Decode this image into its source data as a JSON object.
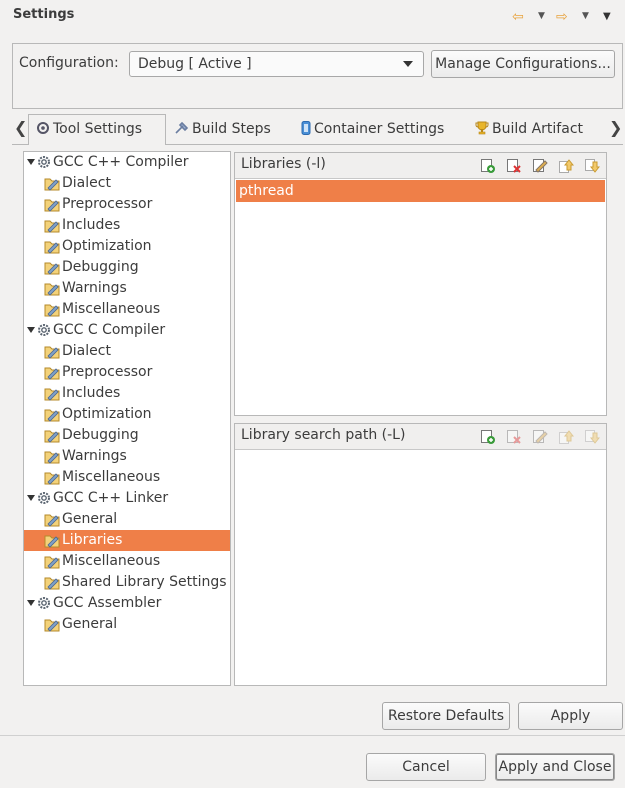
{
  "window": {
    "title": "Settings"
  },
  "configuration": {
    "label": "Configuration:",
    "selected": "Debug  [ Active ]",
    "manage_label": "Manage Configurations..."
  },
  "tabs": [
    {
      "label": "Tool Settings",
      "icon": "tool-settings-icon"
    },
    {
      "label": "Build Steps",
      "icon": "build-steps-icon"
    },
    {
      "label": "Container Settings",
      "icon": "container-icon"
    },
    {
      "label": "Build Artifact",
      "icon": "trophy-icon"
    }
  ],
  "tree": [
    {
      "label": "GCC C++ Compiler",
      "type": "group",
      "icon": "gear-icon"
    },
    {
      "label": "Dialect",
      "type": "leaf",
      "icon": "tool-option-icon"
    },
    {
      "label": "Preprocessor",
      "type": "leaf",
      "icon": "tool-option-icon"
    },
    {
      "label": "Includes",
      "type": "leaf",
      "icon": "tool-option-icon"
    },
    {
      "label": "Optimization",
      "type": "leaf",
      "icon": "tool-option-icon"
    },
    {
      "label": "Debugging",
      "type": "leaf",
      "icon": "tool-option-icon"
    },
    {
      "label": "Warnings",
      "type": "leaf",
      "icon": "tool-option-icon"
    },
    {
      "label": "Miscellaneous",
      "type": "leaf",
      "icon": "tool-option-icon"
    },
    {
      "label": "GCC C Compiler",
      "type": "group",
      "icon": "gear-icon"
    },
    {
      "label": "Dialect",
      "type": "leaf",
      "icon": "tool-option-icon"
    },
    {
      "label": "Preprocessor",
      "type": "leaf",
      "icon": "tool-option-icon"
    },
    {
      "label": "Includes",
      "type": "leaf",
      "icon": "tool-option-icon"
    },
    {
      "label": "Optimization",
      "type": "leaf",
      "icon": "tool-option-icon"
    },
    {
      "label": "Debugging",
      "type": "leaf",
      "icon": "tool-option-icon"
    },
    {
      "label": "Warnings",
      "type": "leaf",
      "icon": "tool-option-icon"
    },
    {
      "label": "Miscellaneous",
      "type": "leaf",
      "icon": "tool-option-icon"
    },
    {
      "label": "GCC C++ Linker",
      "type": "group",
      "icon": "gear-icon"
    },
    {
      "label": "General",
      "type": "leaf",
      "icon": "tool-option-icon"
    },
    {
      "label": "Libraries",
      "type": "leaf",
      "icon": "tool-option-icon",
      "selected": true
    },
    {
      "label": "Miscellaneous",
      "type": "leaf",
      "icon": "tool-option-icon"
    },
    {
      "label": "Shared Library Settings",
      "type": "leaf",
      "icon": "tool-option-icon"
    },
    {
      "label": "GCC Assembler",
      "type": "group",
      "icon": "gear-icon"
    },
    {
      "label": "General",
      "type": "leaf",
      "icon": "tool-option-icon"
    }
  ],
  "libraries_panel": {
    "title": "Libraries (-l)",
    "items": [
      "pthread"
    ]
  },
  "search_path_panel": {
    "title": "Library search path (-L)",
    "items": []
  },
  "buttons": {
    "restore_defaults": "Restore Defaults",
    "apply": "Apply",
    "cancel": "Cancel",
    "apply_and_close": "Apply and Close"
  },
  "colors": {
    "selection": "#ef7f48",
    "background": "#f2f1f0"
  }
}
